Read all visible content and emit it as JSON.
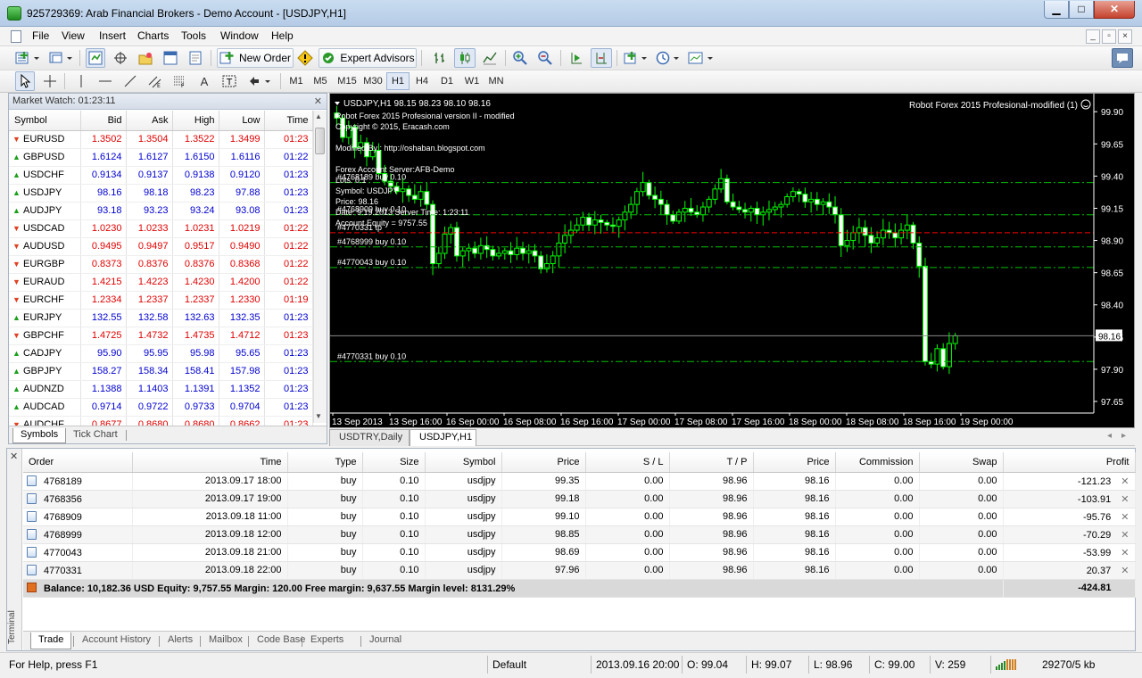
{
  "window": {
    "title": "925729369: Arab Financial Brokers - Demo Account - [USDJPY,H1]",
    "min": "▁",
    "max": "□",
    "close": "✕"
  },
  "menu": [
    "File",
    "View",
    "Insert",
    "Charts",
    "Tools",
    "Window",
    "Help"
  ],
  "toolbar": {
    "new_order": "New Order",
    "expert_advisors": "Expert Advisors"
  },
  "timeframes": [
    "M1",
    "M5",
    "M15",
    "M30",
    "H1",
    "H4",
    "D1",
    "W1",
    "MN"
  ],
  "active_timeframe": "H1",
  "market_watch": {
    "title": "Market Watch: 01:23:11",
    "columns": [
      "Symbol",
      "Bid",
      "Ask",
      "High",
      "Low",
      "Time"
    ],
    "rows": [
      {
        "symbol": "EURUSD",
        "dir": "down",
        "bid": "1.3502",
        "ask": "1.3504",
        "high": "1.3522",
        "low": "1.3499",
        "time": "01:23"
      },
      {
        "symbol": "GBPUSD",
        "dir": "up",
        "bid": "1.6124",
        "ask": "1.6127",
        "high": "1.6150",
        "low": "1.6116",
        "time": "01:22"
      },
      {
        "symbol": "USDCHF",
        "dir": "up",
        "bid": "0.9134",
        "ask": "0.9137",
        "high": "0.9138",
        "low": "0.9120",
        "time": "01:23"
      },
      {
        "symbol": "USDJPY",
        "dir": "up",
        "bid": "98.16",
        "ask": "98.18",
        "high": "98.23",
        "low": "97.88",
        "time": "01:23"
      },
      {
        "symbol": "AUDJPY",
        "dir": "up",
        "bid": "93.18",
        "ask": "93.23",
        "high": "93.24",
        "low": "93.08",
        "time": "01:23"
      },
      {
        "symbol": "USDCAD",
        "dir": "down",
        "bid": "1.0230",
        "ask": "1.0233",
        "high": "1.0231",
        "low": "1.0219",
        "time": "01:22"
      },
      {
        "symbol": "AUDUSD",
        "dir": "down",
        "bid": "0.9495",
        "ask": "0.9497",
        "high": "0.9517",
        "low": "0.9490",
        "time": "01:22"
      },
      {
        "symbol": "EURGBP",
        "dir": "down",
        "bid": "0.8373",
        "ask": "0.8376",
        "high": "0.8376",
        "low": "0.8368",
        "time": "01:22"
      },
      {
        "symbol": "EURAUD",
        "dir": "down",
        "bid": "1.4215",
        "ask": "1.4223",
        "high": "1.4230",
        "low": "1.4200",
        "time": "01:22"
      },
      {
        "symbol": "EURCHF",
        "dir": "down",
        "bid": "1.2334",
        "ask": "1.2337",
        "high": "1.2337",
        "low": "1.2330",
        "time": "01:19"
      },
      {
        "symbol": "EURJPY",
        "dir": "up",
        "bid": "132.55",
        "ask": "132.58",
        "high": "132.63",
        "low": "132.35",
        "time": "01:23"
      },
      {
        "symbol": "GBPCHF",
        "dir": "down",
        "bid": "1.4725",
        "ask": "1.4732",
        "high": "1.4735",
        "low": "1.4712",
        "time": "01:23"
      },
      {
        "symbol": "CADJPY",
        "dir": "up",
        "bid": "95.90",
        "ask": "95.95",
        "high": "95.98",
        "low": "95.65",
        "time": "01:23"
      },
      {
        "symbol": "GBPJPY",
        "dir": "up",
        "bid": "158.27",
        "ask": "158.34",
        "high": "158.41",
        "low": "157.98",
        "time": "01:23"
      },
      {
        "symbol": "AUDNZD",
        "dir": "up",
        "bid": "1.1388",
        "ask": "1.1403",
        "high": "1.1391",
        "low": "1.1352",
        "time": "01:23"
      },
      {
        "symbol": "AUDCAD",
        "dir": "up",
        "bid": "0.9714",
        "ask": "0.9722",
        "high": "0.9733",
        "low": "0.9704",
        "time": "01:23"
      },
      {
        "symbol": "AUDCHF",
        "dir": "down",
        "bid": "0.8677",
        "ask": "0.8680",
        "high": "0.8680",
        "low": "0.8662",
        "time": "01:23"
      }
    ],
    "tabs": [
      "Symbols",
      "Tick Chart"
    ]
  },
  "chart": {
    "header": "USDJPY,H1  98.15 98.23 98.10 98.16",
    "ea_name": "Robot Forex 2015 Profesional-modified (1)",
    "info_lines": [
      "Robot Forex 2015 Profesional version II - modified",
      "Copyright © 2015, Eracash.com",
      "",
      "Modified By : http://oshaban.blogspot.com",
      "",
      "Forex Account Server:AFB-Demo",
      "Lots:  0.1",
      "Symbol: USDJPY",
      "Price:  98.16",
      "Date: 9.19.2013 Server Time: 1:23:11",
      "Account Equity = 9757.55"
    ],
    "order_labels": [
      {
        "text": "#4768189 buy 0.10",
        "price": 99.35
      },
      {
        "text": "#4768909 buy 0.10",
        "price": 99.1
      },
      {
        "text": "#4770331 tp",
        "price": 98.96
      },
      {
        "text": "#4768999 buy 0.10",
        "price": 98.85
      },
      {
        "text": "#4770043 buy 0.10",
        "price": 98.69
      },
      {
        "text": "#4770331 buy 0.10",
        "price": 97.96
      }
    ],
    "current_price": "98.16",
    "tabs": [
      "USDTRY,Daily",
      "USDJPY,H1"
    ]
  },
  "chart_data": {
    "type": "candlestick",
    "symbol": "USDJPY",
    "timeframe": "H1",
    "y_ticks": [
      "99.90",
      "99.65",
      "99.40",
      "99.15",
      "98.90",
      "98.65",
      "98.40",
      "98.15",
      "97.90",
      "97.65"
    ],
    "ylim": [
      97.56,
      100.04
    ],
    "x_ticks": [
      "13 Sep 2013",
      "13 Sep 16:00",
      "16 Sep 00:00",
      "16 Sep 08:00",
      "16 Sep 16:00",
      "17 Sep 00:00",
      "17 Sep 08:00",
      "17 Sep 16:00",
      "18 Sep 00:00",
      "18 Sep 08:00",
      "18 Sep 16:00",
      "19 Sep 00:00"
    ],
    "close_path": [
      99.85,
      99.7,
      99.78,
      99.62,
      99.66,
      99.55,
      99.6,
      99.42,
      99.36,
      99.32,
      99.28,
      99.3,
      99.25,
      99.22,
      99.28,
      99.18,
      98.72,
      98.8,
      98.95,
      99.0,
      98.78,
      98.82,
      98.84,
      98.8,
      98.86,
      98.83,
      98.78,
      98.8,
      98.82,
      98.79,
      98.84,
      98.8,
      98.82,
      98.78,
      98.68,
      98.72,
      98.78,
      98.88,
      98.94,
      98.98,
      99.02,
      99.08,
      99.02,
      99.06,
      99.04,
      99.02,
      99.01,
      99.06,
      99.12,
      99.18,
      99.28,
      99.35,
      99.25,
      99.22,
      99.18,
      99.1,
      99.05,
      99.12,
      99.15,
      99.12,
      99.1,
      99.16,
      99.22,
      99.3,
      99.38,
      99.2,
      99.16,
      99.14,
      99.12,
      99.15,
      99.1,
      99.12,
      99.14,
      99.16,
      99.18,
      99.24,
      99.28,
      99.26,
      99.2,
      99.22,
      99.18,
      99.2,
      99.16,
      99.1,
      98.86,
      98.9,
      98.96,
      99.0,
      98.94,
      98.88,
      98.92,
      98.98,
      98.96,
      98.92,
      98.98,
      99.02,
      98.88,
      98.7,
      97.96,
      97.94,
      98.06,
      97.92,
      98.1,
      98.16
    ],
    "lines": [
      99.35,
      99.1,
      98.96,
      98.85,
      98.69,
      97.96
    ],
    "current_price": 98.16
  },
  "trade": {
    "columns": [
      "Order",
      "Time",
      "Type",
      "Size",
      "Symbol",
      "Price",
      "S / L",
      "T / P",
      "Price",
      "Commission",
      "Swap",
      "Profit"
    ],
    "rows": [
      [
        "4768189",
        "2013.09.17 18:00",
        "buy",
        "0.10",
        "usdjpy",
        "99.35",
        "0.00",
        "98.96",
        "98.16",
        "0.00",
        "0.00",
        "-121.23"
      ],
      [
        "4768356",
        "2013.09.17 19:00",
        "buy",
        "0.10",
        "usdjpy",
        "99.18",
        "0.00",
        "98.96",
        "98.16",
        "0.00",
        "0.00",
        "-103.91"
      ],
      [
        "4768909",
        "2013.09.18 11:00",
        "buy",
        "0.10",
        "usdjpy",
        "99.10",
        "0.00",
        "98.96",
        "98.16",
        "0.00",
        "0.00",
        "-95.76"
      ],
      [
        "4768999",
        "2013.09.18 12:00",
        "buy",
        "0.10",
        "usdjpy",
        "98.85",
        "0.00",
        "98.96",
        "98.16",
        "0.00",
        "0.00",
        "-70.29"
      ],
      [
        "4770043",
        "2013.09.18 21:00",
        "buy",
        "0.10",
        "usdjpy",
        "98.69",
        "0.00",
        "98.96",
        "98.16",
        "0.00",
        "0.00",
        "-53.99"
      ],
      [
        "4770331",
        "2013.09.18 22:00",
        "buy",
        "0.10",
        "usdjpy",
        "97.96",
        "0.00",
        "98.96",
        "98.16",
        "0.00",
        "0.00",
        "20.37"
      ]
    ],
    "balance_text": "Balance: 10,182.36 USD  Equity: 9,757.55  Margin: 120.00  Free margin: 9,637.55  Margin level: 8131.29%",
    "total_profit": "-424.81",
    "tabs": [
      "Trade",
      "Account History",
      "Alerts",
      "Mailbox",
      "Code Base",
      "Experts",
      "Journal"
    ],
    "side_label": "Terminal"
  },
  "status": {
    "help": "For Help, press F1",
    "profile": "Default",
    "datetime": "2013.09.16 20:00",
    "open": "O: 99.04",
    "high": "H: 99.07",
    "low": "L: 98.96",
    "close": "C: 99.00",
    "volume": "V: 259",
    "traffic": "29270/5 kb"
  }
}
